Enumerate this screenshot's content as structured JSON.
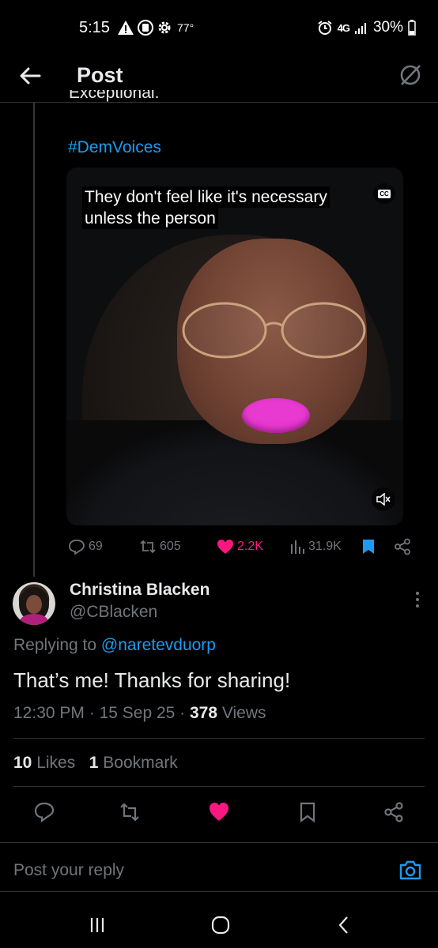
{
  "status_bar": {
    "time": "5:15",
    "temperature": "77°",
    "network": "4G",
    "battery": "30%",
    "icons": [
      "warning-icon",
      "sim-icon",
      "gear-icon",
      "alarm-icon",
      "signal-icon",
      "battery-icon"
    ]
  },
  "header": {
    "title": "Post",
    "icons": [
      "back-arrow-icon",
      "grok-icon"
    ]
  },
  "parent_post": {
    "cut_text": "Exceptional.",
    "hashtag": "#DemVoices",
    "video": {
      "caption_line1": "They don't feel like it's necessary",
      "caption_line2": "unless the person",
      "cc_label": "CC"
    },
    "actions": {
      "replies": "69",
      "reposts": "605",
      "likes": "2.2K",
      "views": "31.9K"
    },
    "colors": {
      "like": "#f91880",
      "bookmark": "#1d9bf0",
      "accent": "#1d9bf0"
    }
  },
  "reply_post": {
    "name": "Christina Blacken",
    "handle": "@CBlacken",
    "replying_prefix": "Replying to",
    "replying_to": "@naretevduorp",
    "text": "That’s me! Thanks for sharing!",
    "time": "12:30 PM",
    "date": "15 Sep 25",
    "views_count": "378",
    "views_label": "Views",
    "likes_count": "10",
    "likes_label": "Likes",
    "bookmarks_count": "1",
    "bookmarks_label": "Bookmark"
  },
  "reply_composer": {
    "placeholder": "Post your reply"
  }
}
